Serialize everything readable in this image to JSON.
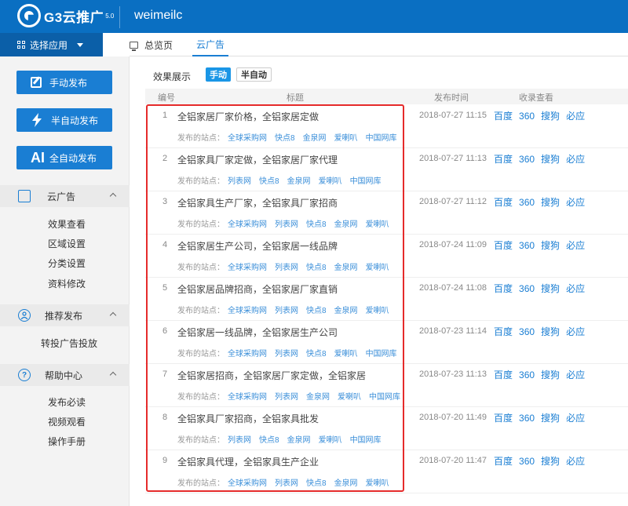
{
  "header": {
    "brand": "G3云推广",
    "version": "5.0",
    "username": "weimeilc"
  },
  "app_selector": {
    "label": "选择应用"
  },
  "sidebar": {
    "publish_buttons": [
      {
        "label": "手动发布",
        "icon": "edit-icon"
      },
      {
        "label": "半自动发布",
        "icon": "lightning-icon"
      },
      {
        "label": "全自动发布",
        "icon_text": "AI"
      }
    ],
    "sections": [
      {
        "title": "云广告",
        "icon": "document-search-icon",
        "items": [
          "效果查看",
          "区域设置",
          "分类设置",
          "资料修改"
        ]
      },
      {
        "title": "推荐发布",
        "icon": "user-icon",
        "items": [
          "转投广告投放"
        ]
      },
      {
        "title": "帮助中心",
        "icon": "question-icon",
        "items": [
          "发布必读",
          "视频观看",
          "操作手册"
        ]
      }
    ]
  },
  "tabs": [
    {
      "label": "总览页",
      "icon": "monitor-icon"
    },
    {
      "label": "云广告",
      "active": true
    }
  ],
  "filter": {
    "label": "效果展示",
    "modes": [
      "手动",
      "半自动"
    ],
    "active_mode": "手动"
  },
  "table": {
    "headers": {
      "num": "编号",
      "title": "标题",
      "time": "发布时间",
      "index": "收录查看"
    },
    "sites_label": "发布的站点：",
    "engines": [
      "百度",
      "360",
      "搜狗",
      "必应"
    ],
    "rows": [
      {
        "num": "1",
        "title": "全铝家居厂家价格，全铝家居定做",
        "sites": [
          "全球采购网",
          "快点8",
          "金泉网",
          "爱喇叭",
          "中国网库"
        ],
        "time": "2018-07-27 11:15"
      },
      {
        "num": "2",
        "title": "全铝家具厂家定做，全铝家居厂家代理",
        "sites": [
          "列表网",
          "快点8",
          "金泉网",
          "爱喇叭",
          "中国网库"
        ],
        "time": "2018-07-27 11:13"
      },
      {
        "num": "3",
        "title": "全铝家具生产厂家，全铝家具厂家招商",
        "sites": [
          "全球采购网",
          "列表网",
          "快点8",
          "金泉网",
          "爱喇叭"
        ],
        "time": "2018-07-27 11:12"
      },
      {
        "num": "4",
        "title": "全铝家居生产公司，全铝家居一线品牌",
        "sites": [
          "全球采购网",
          "列表网",
          "快点8",
          "金泉网",
          "爱喇叭"
        ],
        "time": "2018-07-24 11:09"
      },
      {
        "num": "5",
        "title": "全铝家居品牌招商，全铝家居厂家直销",
        "sites": [
          "全球采购网",
          "列表网",
          "快点8",
          "金泉网",
          "爱喇叭"
        ],
        "time": "2018-07-24 11:08"
      },
      {
        "num": "6",
        "title": "全铝家居一线品牌，全铝家居生产公司",
        "sites": [
          "全球采购网",
          "列表网",
          "快点8",
          "爱喇叭",
          "中国网库"
        ],
        "time": "2018-07-23 11:14"
      },
      {
        "num": "7",
        "title": "全铝家居招商，全铝家居厂家定做，全铝家居",
        "sites": [
          "全球采购网",
          "列表网",
          "金泉网",
          "爱喇叭",
          "中国网库"
        ],
        "time": "2018-07-23 11:13"
      },
      {
        "num": "8",
        "title": "全铝家具厂家招商，全铝家具批发",
        "sites": [
          "列表网",
          "快点8",
          "金泉网",
          "爱喇叭",
          "中国网库"
        ],
        "time": "2018-07-20 11:49"
      },
      {
        "num": "9",
        "title": "全铝家具代理，全铝家具生产企业",
        "sites": [
          "全球采购网",
          "列表网",
          "快点8",
          "金泉网",
          "爱喇叭"
        ],
        "time": "2018-07-20 11:47"
      }
    ]
  },
  "colors": {
    "brand": "#0a6fc2",
    "accent": "#1a7ed3",
    "highlight": "#e52b2b"
  }
}
